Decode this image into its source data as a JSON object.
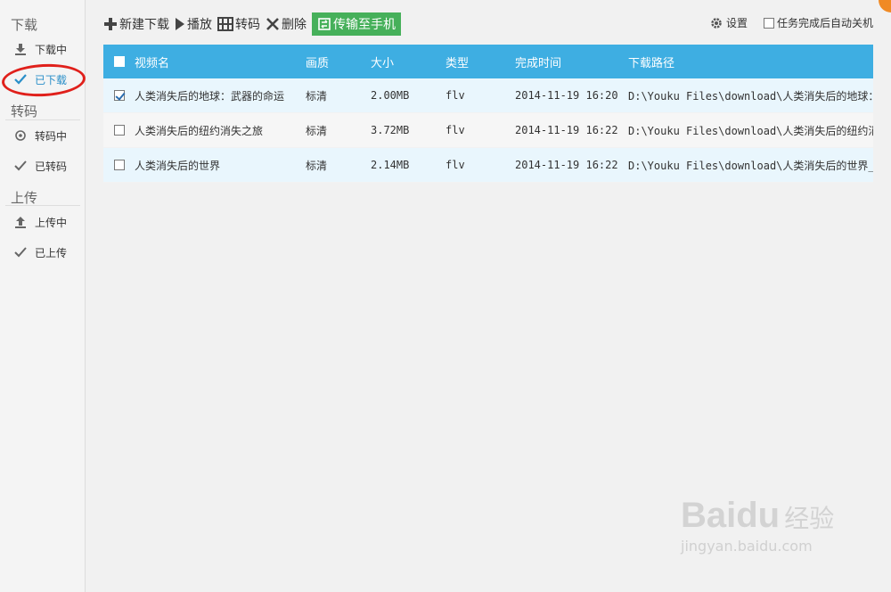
{
  "sidebar": {
    "download_title": "下载",
    "downloading_label": "下载中",
    "downloaded_label": "已下载",
    "transcode_title": "转码",
    "transcoding_label": "转码中",
    "transcoded_label": "已转码",
    "upload_title": "上传",
    "uploading_label": "上传中",
    "uploaded_label": "已上传",
    "active_item": "已下载"
  },
  "toolbar": {
    "new_download": "新建下载",
    "play": "播放",
    "transcode": "转码",
    "delete": "删除",
    "transfer_to_phone": "传输至手机",
    "settings": "设置",
    "auto_shutdown": "任务完成后自动关机"
  },
  "table": {
    "headers": {
      "name": "视频名",
      "quality": "画质",
      "size": "大小",
      "type": "类型",
      "completed": "完成时间",
      "path": "下载路径"
    },
    "rows": [
      {
        "checked": true,
        "name": "人类消失后的地球：武器的命运",
        "quality": "标清",
        "size": "2.00MB",
        "type": "flv",
        "completed": "2014-11-19 16:20",
        "path": "D:\\Youku Files\\download\\人类消失后的地球：武器的命运"
      },
      {
        "checked": false,
        "name": "人类消失后的纽约消失之旅",
        "quality": "标清",
        "size": "3.72MB",
        "type": "flv",
        "completed": "2014-11-19 16:22",
        "path": "D:\\Youku Files\\download\\人类消失后的纽约消失之旅"
      },
      {
        "checked": false,
        "name": "人类消失后的世界",
        "quality": "标清",
        "size": "2.14MB",
        "type": "flv",
        "completed": "2014-11-19 16:22",
        "path": "D:\\Youku Files\\download\\人类消失后的世界_标清"
      }
    ]
  },
  "watermark": {
    "logo": "Baidu",
    "cn": "经验",
    "url": "jingyan.baidu.com"
  },
  "colors": {
    "accent": "#3eaee2",
    "green_button": "#46b05a",
    "highlight_ring": "#e0201b",
    "row_alt": "#e9f6fd"
  }
}
